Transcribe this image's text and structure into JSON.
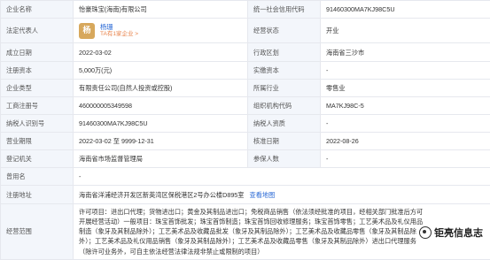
{
  "rows": {
    "r1": {
      "l1": "企业名称",
      "v1": "怡豪珠宝(海南)有限公司",
      "l2": "统一社会信用代码",
      "v2": "91460300MA7KJ98C5U"
    },
    "r2": {
      "l1": "法定代表人",
      "avatar": "杨",
      "name": "杨珊",
      "link": "TA有1家企业 >",
      "l2": "经营状态",
      "v2": "开业"
    },
    "r3": {
      "l1": "成立日期",
      "v1": "2022-03-02",
      "l2": "行政区划",
      "v2": "海南省三沙市"
    },
    "r4": {
      "l1": "注册资本",
      "v1": "5,000万(元)",
      "l2": "实缴资本",
      "v2": "-"
    },
    "r5": {
      "l1": "企业类型",
      "v1": "有限责任公司(自然人投资或控股)",
      "l2": "所属行业",
      "v2": "零售业"
    },
    "r6": {
      "l1": "工商注册号",
      "v1": "460000005349598",
      "l2": "组织机构代码",
      "v2": "MA7KJ98C-5"
    },
    "r7": {
      "l1": "纳税人识别号",
      "v1": "91460300MA7KJ98C5U",
      "l2": "纳税人资质",
      "v2": "-"
    },
    "r8": {
      "l1": "营业期限",
      "v1": "2022-03-02 至 9999-12-31",
      "l2": "核准日期",
      "v2": "2022-08-26"
    },
    "r9": {
      "l1": "登记机关",
      "v1": "海南省市场监督管理局",
      "l2": "参保人数",
      "v2": "-"
    },
    "r10": {
      "l1": "曾用名",
      "v1": "-"
    },
    "r11": {
      "l1": "注册地址",
      "v1": "海南省洋浦经济开发区新英湾区保税港区2号办公楼D895室",
      "map": "查看地图"
    },
    "r12": {
      "l1": "经营范围",
      "v1": "许可项目：进出口代理；货物进出口；黄金及其制品进出口；免税商品销售（依法须经批准的项目，经相关部门批准后方可开展经营活动）一般项目：珠宝首饰批发；珠宝首饰制造；珠宝首饰回收修理服务；珠宝首饰零售；工艺美术品及礼仪用品制造（象牙及其制品除外）；工艺美术品及收藏品批发（象牙及其制品除外）；工艺美术品及收藏品零售（象牙及其制品除外）；工艺美术品及礼仪用品销售（象牙及其制品除外）；工艺美术品及收藏品零售（象牙及其制品除外）进出口代理服务（除许可业务外，可自主依法经营法律法规非禁止或限制的项目）"
    }
  },
  "watermark": "钜亮信息志"
}
